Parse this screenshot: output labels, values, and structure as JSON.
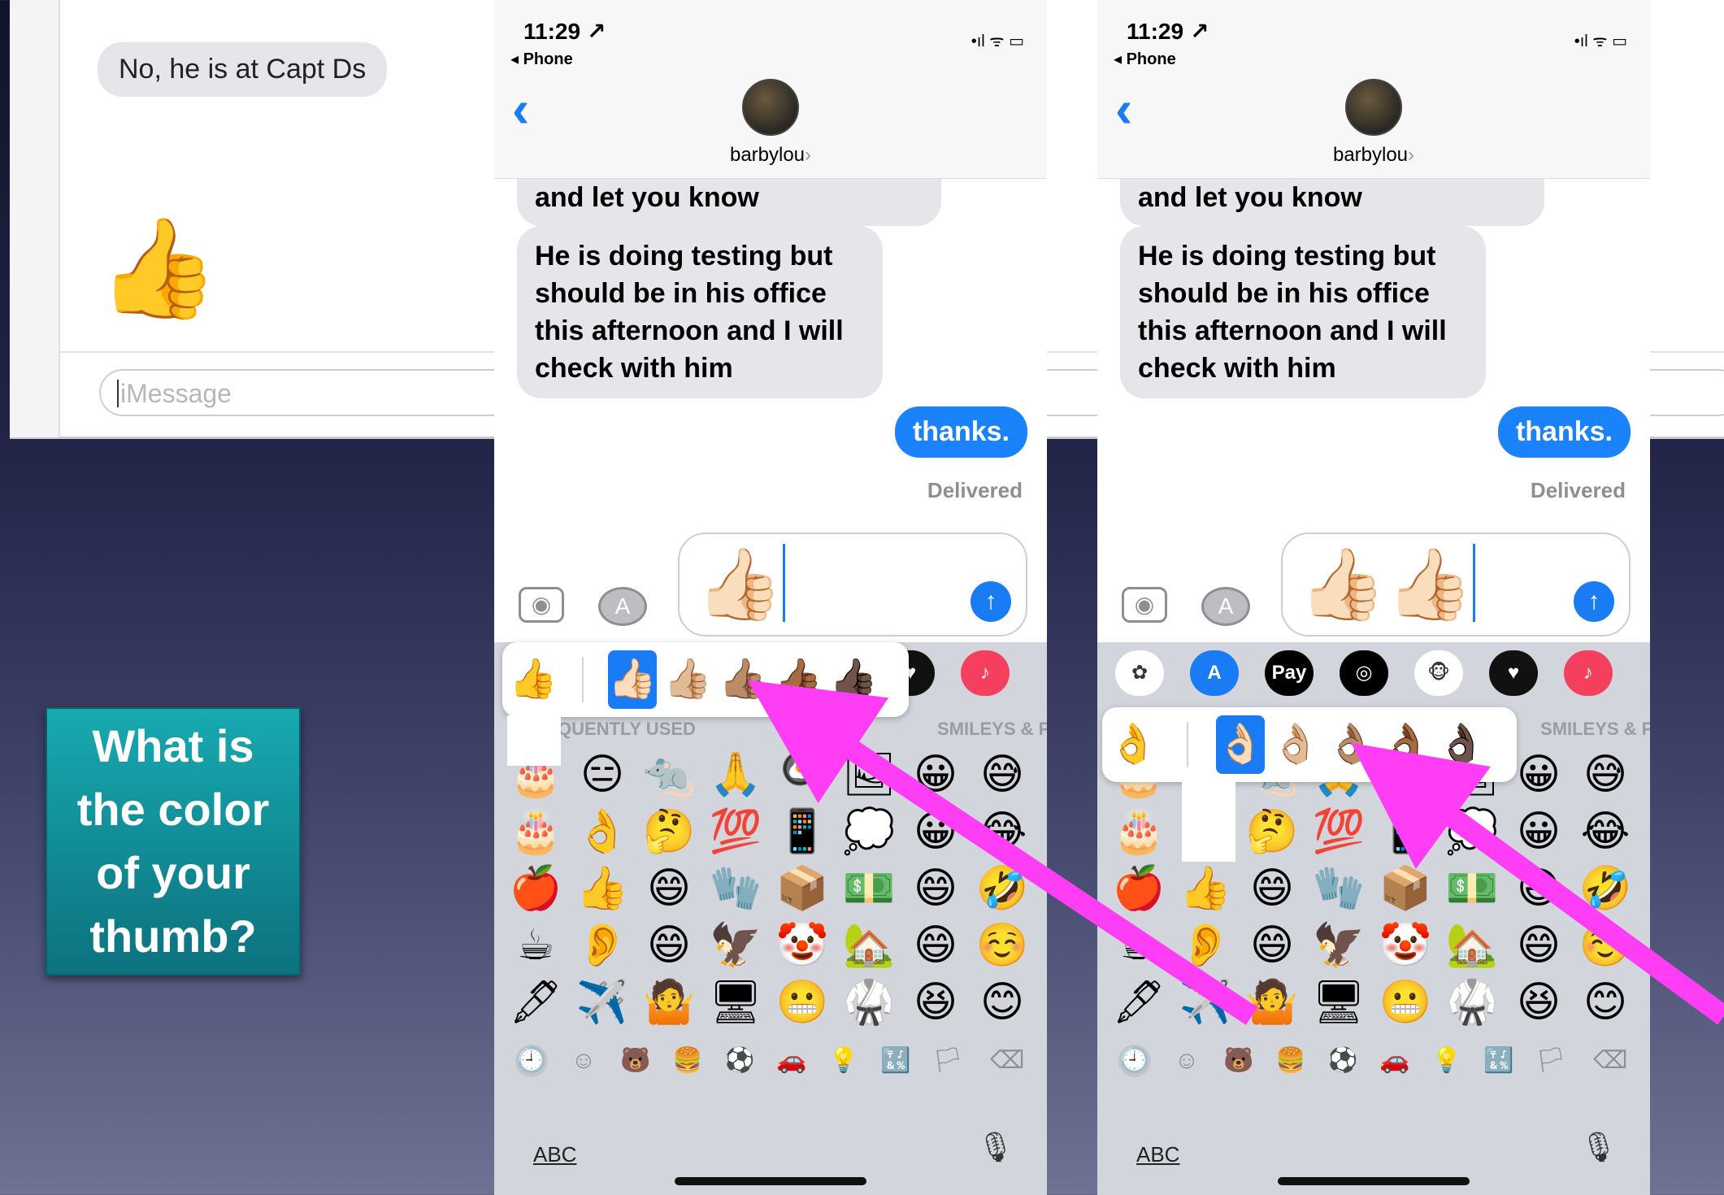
{
  "mac_messages": {
    "received_text": "No, he is at Capt Ds",
    "sent_emoji": "👍",
    "input_placeholder": "iMessage"
  },
  "callout": {
    "text": "What is the color of your thumb?",
    "background": "#0f8e98"
  },
  "phones": [
    {
      "status": {
        "time": "11:29 ↗",
        "back_app": "◂ Phone",
        "icons": "•ıl ᯤ ▭"
      },
      "contact": {
        "name": "barbylou",
        "chevron": "›"
      },
      "thread": {
        "clipped_message": "and let you know",
        "message": "He is doing testing but should be in his office this afternoon and I will check with him",
        "sent_message": "thanks.",
        "delivered": "Delivered"
      },
      "compose": {
        "text": "👍🏻",
        "send_icon": "↑"
      },
      "apps": [
        {
          "name": "photos-app",
          "glyph": "✿",
          "color": "#ffffff"
        },
        {
          "name": "app-store-app",
          "glyph": "A",
          "color": "#1a7cf5"
        },
        {
          "name": "apple-pay-app",
          "glyph": "Pay",
          "color": "#000000"
        },
        {
          "name": "activity-app",
          "glyph": "◎",
          "color": "#000000"
        },
        {
          "name": "animoji-app",
          "glyph": "🐵",
          "color": "#ffffff"
        },
        {
          "name": "digital-touch-app",
          "glyph": "♥",
          "color": "#111111"
        },
        {
          "name": "music-app",
          "glyph": "♪",
          "color": "#f43f5e"
        }
      ],
      "section_labels": {
        "left": "FREQUENTLY USED",
        "right": "SMILEYS & P"
      },
      "emoji_rows": [
        [
          "🎂",
          "😑",
          "🐀",
          "🙏",
          "🍳",
          "🖼",
          "😀",
          "😅"
        ],
        [
          "🎂",
          "👌",
          "🤔",
          "💯",
          "📱",
          "💭",
          "😀",
          "😂"
        ],
        [
          "🍎",
          "👍",
          "😄",
          "🧤",
          "📦",
          "💵",
          "😄",
          "🤣"
        ],
        [
          "☕",
          "👂",
          "😄",
          "🦅",
          "🤡",
          "🏡",
          "😄",
          "☺️"
        ],
        [
          "🖋",
          "✈️",
          "🤷",
          "🖥",
          "😬",
          "🥋",
          "😆",
          "😊"
        ]
      ],
      "popup": {
        "type": "thumbs",
        "options": [
          "👍",
          "👍🏻",
          "👍🏼",
          "👍🏽",
          "👍🏾",
          "👍🏿"
        ],
        "selected_index": 1
      },
      "categories": [
        "🕘",
        "☺",
        "🐻",
        "🍔",
        "⚽",
        "🚗",
        "💡",
        "🔣",
        "🏳",
        "⌫"
      ],
      "abc": "ABC",
      "mic": "🎙"
    },
    {
      "status": {
        "time": "11:29 ↗",
        "back_app": "◂ Phone",
        "icons": "•ıl ᯤ ▭"
      },
      "contact": {
        "name": "barbylou",
        "chevron": "›"
      },
      "thread": {
        "clipped_message": "and let you know",
        "message": "He is doing testing but should be in his office this afternoon and I will check with him",
        "sent_message": "thanks.",
        "delivered": "Delivered"
      },
      "compose": {
        "text": "👍🏻👍🏻",
        "send_icon": "↑"
      },
      "apps": [
        {
          "name": "photos-app",
          "glyph": "✿",
          "color": "#ffffff"
        },
        {
          "name": "app-store-app",
          "glyph": "A",
          "color": "#1a7cf5"
        },
        {
          "name": "apple-pay-app",
          "glyph": "Pay",
          "color": "#000000"
        },
        {
          "name": "activity-app",
          "glyph": "◎",
          "color": "#000000"
        },
        {
          "name": "animoji-app",
          "glyph": "🐵",
          "color": "#ffffff"
        },
        {
          "name": "digital-touch-app",
          "glyph": "♥",
          "color": "#111111"
        },
        {
          "name": "music-app",
          "glyph": "♪",
          "color": "#f43f5e"
        }
      ],
      "section_labels": {
        "left": "",
        "right": "SMILEYS & P"
      },
      "emoji_rows": [
        [
          "🎂",
          "😑",
          "🐀",
          "🙏",
          "🍳",
          "🖼",
          "😀",
          "😅"
        ],
        [
          "🎂",
          "👌",
          "🤔",
          "💯",
          "📱",
          "💭",
          "😀",
          "😂"
        ],
        [
          "🍎",
          "👍",
          "😄",
          "🧤",
          "📦",
          "💵",
          "😄",
          "🤣"
        ],
        [
          "☕",
          "👂",
          "😄",
          "🦅",
          "🤡",
          "🏡",
          "😄",
          "☺️"
        ],
        [
          "🖋",
          "✈️",
          "🤷",
          "🖥",
          "😬",
          "🥋",
          "😆",
          "😊"
        ]
      ],
      "popup": {
        "type": "ok-hands",
        "options": [
          "👌",
          "👌🏻",
          "👌🏼",
          "👌🏽",
          "👌🏾",
          "👌🏿"
        ],
        "selected_index": 1
      },
      "categories": [
        "🕘",
        "☺",
        "🐻",
        "🍔",
        "⚽",
        "🚗",
        "💡",
        "🔣",
        "🏳",
        "⌫"
      ],
      "abc": "ABC",
      "mic": "🎙"
    }
  ],
  "annotation": {
    "arrow_color": "#ff3df5"
  }
}
